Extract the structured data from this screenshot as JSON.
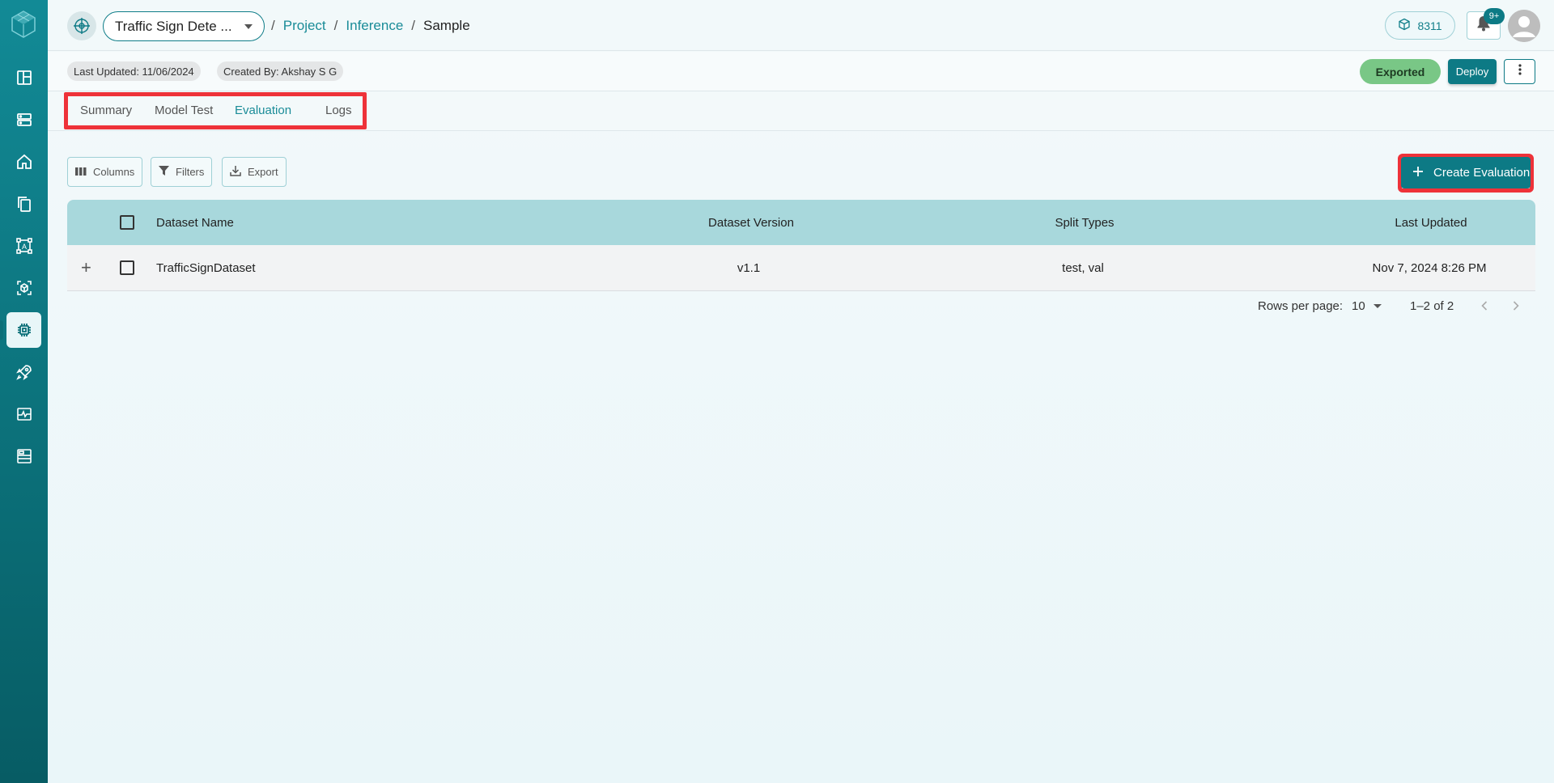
{
  "sidebar": {
    "logo_icon": "cube-logo-icon",
    "items": [
      {
        "name": "dashboard-icon"
      },
      {
        "name": "storage-icon"
      },
      {
        "name": "home-icon"
      },
      {
        "name": "documents-icon"
      },
      {
        "name": "annotation-icon"
      },
      {
        "name": "model-icon"
      },
      {
        "name": "inference-icon",
        "active": true
      },
      {
        "name": "deploy-rocket-icon"
      },
      {
        "name": "monitoring-icon"
      },
      {
        "name": "reports-icon"
      }
    ]
  },
  "header": {
    "project_select": "Traffic Sign Dete ...",
    "breadcrumb": {
      "sep": "/",
      "project": "Project",
      "inference": "Inference",
      "current": "Sample"
    },
    "credits": "8311",
    "notifications_badge": "9+"
  },
  "meta": {
    "last_updated": "Last Updated: 11/06/2024",
    "created_by": "Created By: Akshay S G",
    "status": "Exported",
    "deploy": "Deploy"
  },
  "tabs": {
    "summary": "Summary",
    "model_test": "Model Test",
    "evaluation": "Evaluation",
    "logs": "Logs",
    "active": "Evaluation"
  },
  "toolbar": {
    "columns": "Columns",
    "filters": "Filters",
    "export": "Export",
    "create": "Create Evaluation"
  },
  "table": {
    "headers": {
      "dataset_name": "Dataset Name",
      "dataset_version": "Dataset Version",
      "split_types": "Split Types",
      "last_updated": "Last Updated"
    },
    "rows": [
      {
        "dataset_name": "TrafficSignDataset",
        "dataset_version": "v1.1",
        "split_types": "test, val",
        "last_updated": "Nov 7, 2024 8:26 PM"
      }
    ]
  },
  "pagination": {
    "rows_per_page_label": "Rows per page:",
    "rows_per_page": "10",
    "range": "1–2 of 2"
  },
  "colors": {
    "accent": "#0d7a85",
    "highlight": "#ee3239",
    "exported": "#79c786",
    "table_header": "#a8d8dc"
  }
}
